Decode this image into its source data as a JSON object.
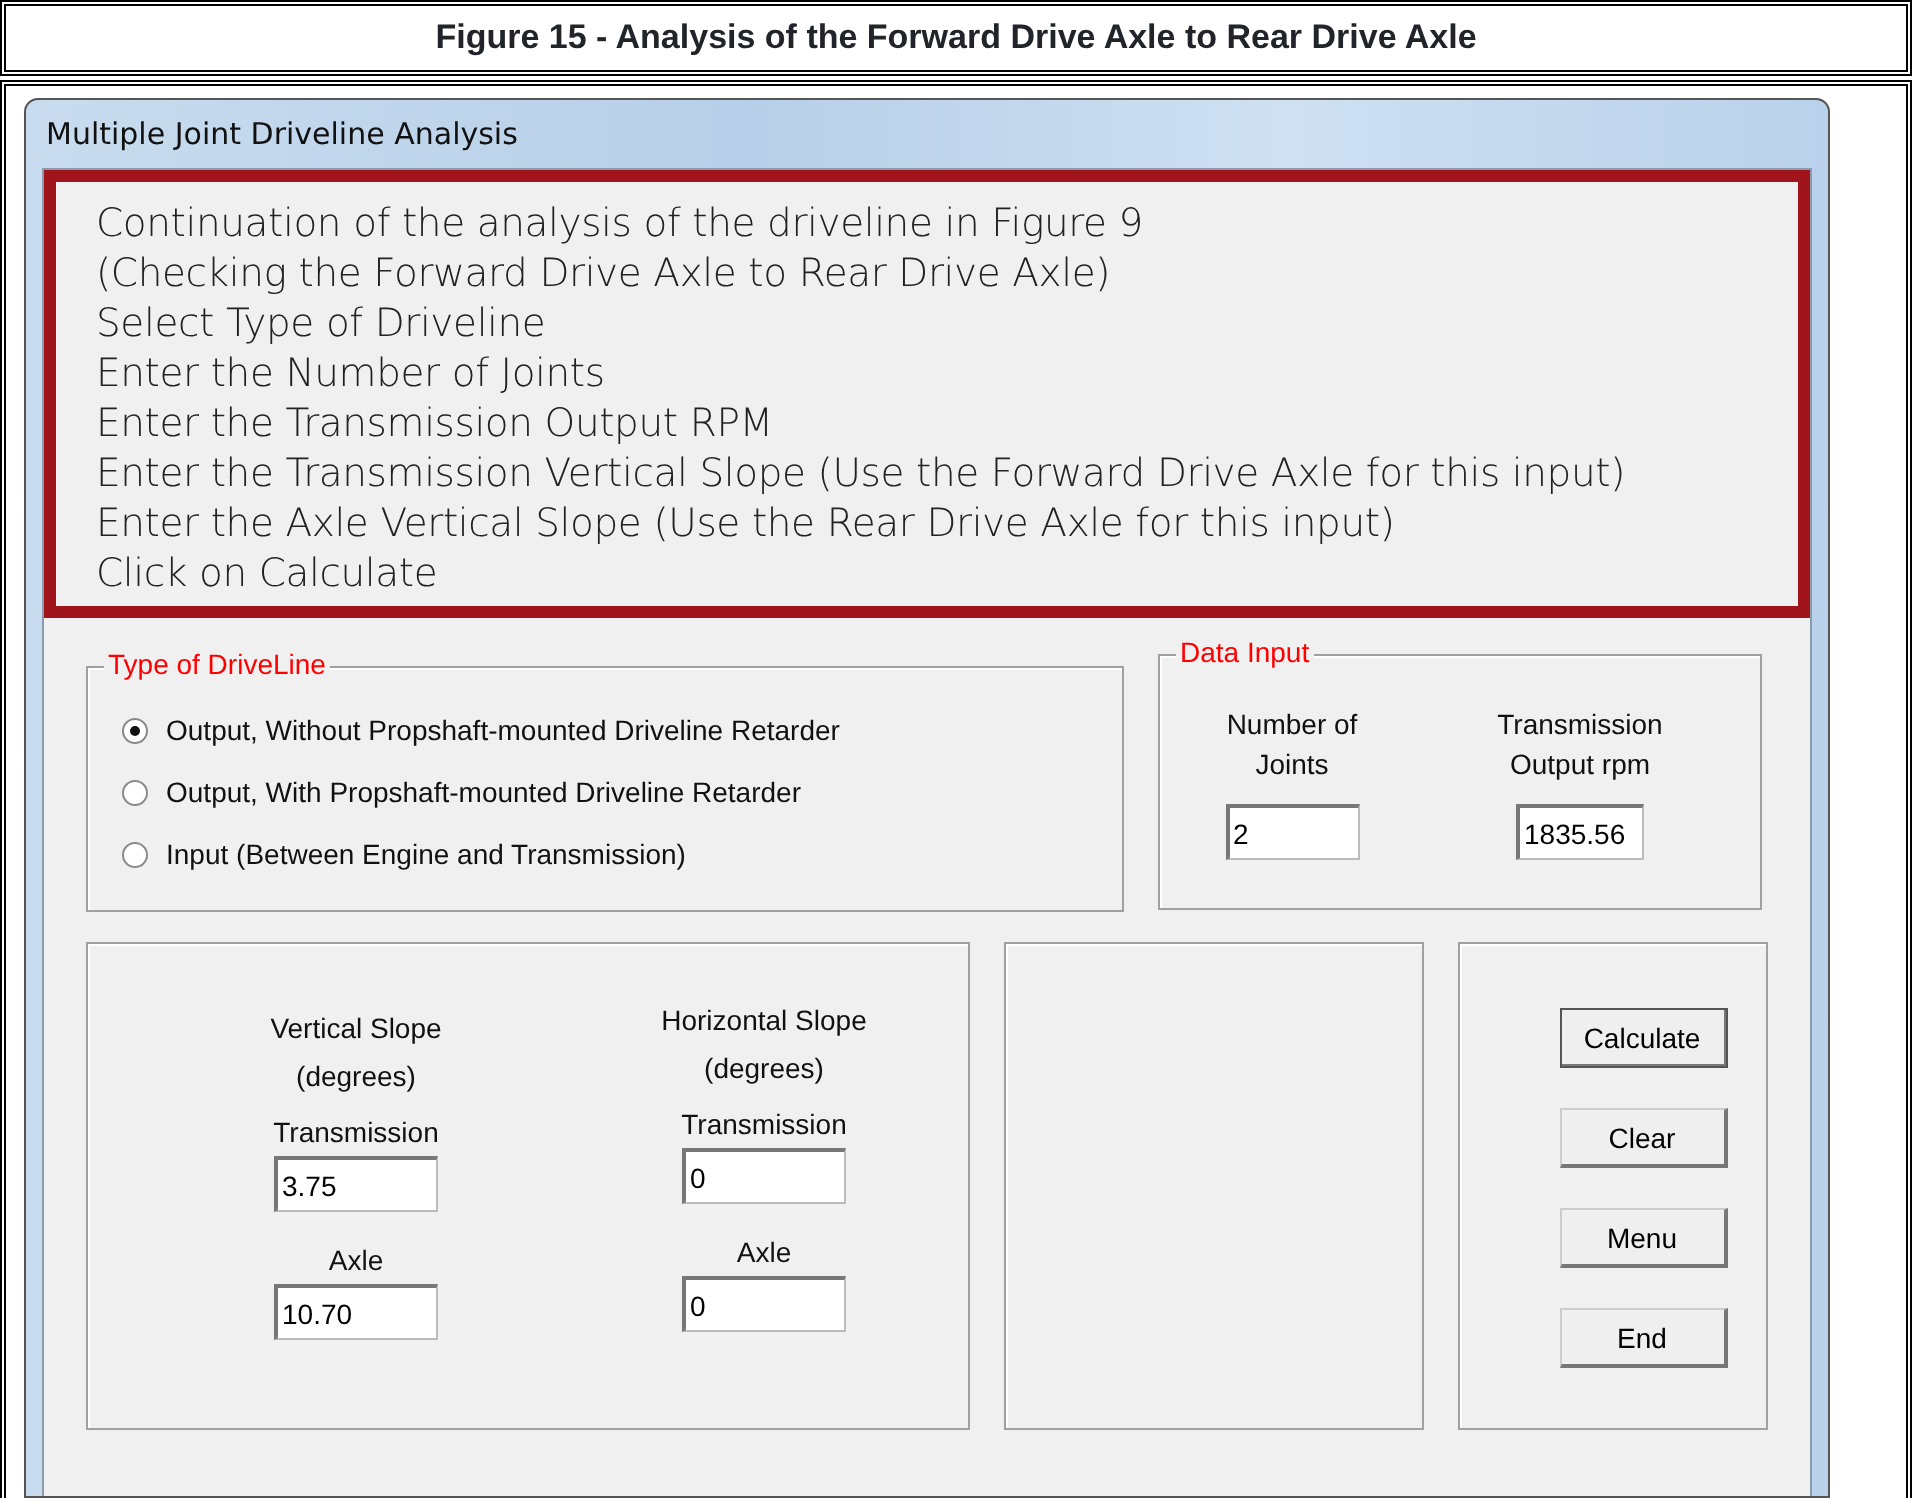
{
  "figure_title": "Figure 15 - Analysis of the Forward Drive Axle to Rear Drive Axle",
  "window": {
    "title": "Multiple Joint Driveline Analysis"
  },
  "instructions": [
    "Continuation of the analysis of the driveline in Figure 9",
    "(Checking the Forward Drive Axle to Rear Drive Axle)",
    "Select Type of Driveline",
    "Enter the Number of Joints",
    "Enter the Transmission Output RPM",
    "Enter the Transmission Vertical Slope (Use the Forward Drive Axle for this input)",
    "Enter the Axle Vertical Slope (Use the Rear Drive Axle for this input)",
    "Click on Calculate"
  ],
  "driveline_type": {
    "legend": "Type of DriveLine",
    "options": [
      {
        "label": "Output, Without Propshaft-mounted Driveline Retarder",
        "selected": true
      },
      {
        "label": "Output, With Propshaft-mounted Driveline Retarder",
        "selected": false
      },
      {
        "label": "Input (Between Engine and Transmission)",
        "selected": false
      }
    ]
  },
  "data_input": {
    "legend": "Data Input",
    "fields": [
      {
        "label": "Number of Joints",
        "value": "2"
      },
      {
        "label": "Transmission Output rpm",
        "value": "1835.56"
      }
    ]
  },
  "slopes": [
    {
      "heading": "Vertical Slope",
      "unit": "(degrees)",
      "fields": [
        {
          "label": "Transmission",
          "value": "3.75"
        },
        {
          "label": "Axle",
          "value": "10.70"
        }
      ]
    },
    {
      "heading": "Horizontal Slope",
      "unit": "(degrees)",
      "fields": [
        {
          "label": "Transmission",
          "value": "0"
        },
        {
          "label": "Axle",
          "value": "0"
        }
      ]
    }
  ],
  "buttons": [
    {
      "label": "Calculate",
      "default": true
    },
    {
      "label": "Clear",
      "default": false
    },
    {
      "label": "Menu",
      "default": false
    },
    {
      "label": "End",
      "default": false
    }
  ]
}
